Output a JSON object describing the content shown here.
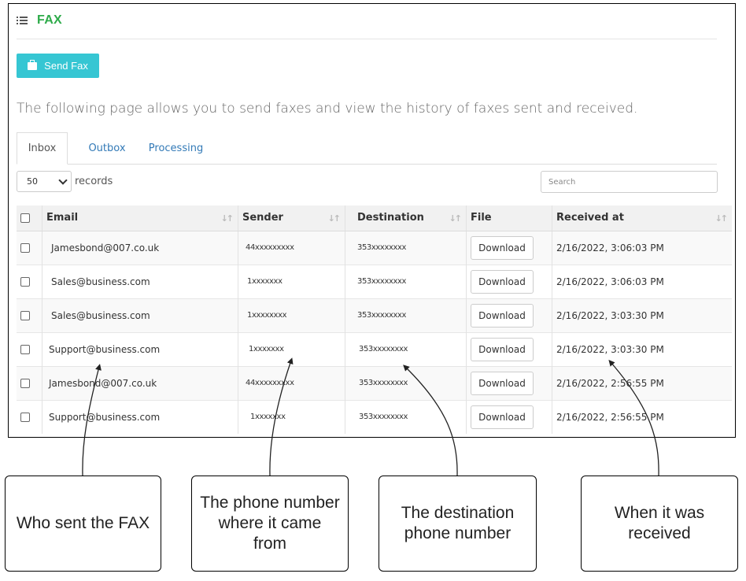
{
  "header": {
    "title": "FAX",
    "menu_icon": "list-icon"
  },
  "actions": {
    "send_fax_label": "Send Fax",
    "send_fax_icon": "briefcase-icon",
    "accent_color": "#36c6d3"
  },
  "description": "The following page allows you to send faxes and view the history of faxes sent and received.",
  "tabs": [
    {
      "label": "Inbox",
      "active": true
    },
    {
      "label": "Outbox",
      "active": false
    },
    {
      "label": "Processing",
      "active": false
    }
  ],
  "length": {
    "value": "50",
    "label": "records"
  },
  "search": {
    "placeholder": "Search",
    "value": ""
  },
  "table": {
    "columns": [
      "Email",
      "Sender",
      "Destination",
      "File",
      "Received at"
    ],
    "rows": [
      {
        "email": "Jamesbond@007.co.uk",
        "sender": "44xxxxxxxxx",
        "destination": "353xxxxxxxx",
        "file": "Download",
        "received": "2/16/2022, 3:06:03 PM"
      },
      {
        "email": "Sales@business.com",
        "sender": "1xxxxxxx",
        "destination": "353xxxxxxxx",
        "file": "Download",
        "received": "2/16/2022, 3:06:03 PM"
      },
      {
        "email": "Sales@business.com",
        "sender": "1xxxxxxxx",
        "destination": "353xxxxxxxx",
        "file": "Download",
        "received": "2/16/2022, 3:03:30 PM"
      },
      {
        "email": "Support@business.com",
        "sender": "1xxxxxxx",
        "destination": "353xxxxxxxx",
        "file": "Download",
        "received": "2/16/2022, 3:03:30 PM"
      },
      {
        "email": "Jamesbond@007.co.uk",
        "sender": "44xxxxxxxxx",
        "destination": "353xxxxxxxx",
        "file": "Download",
        "received": "2/16/2022, 2:56:55 PM"
      },
      {
        "email": "Support@business.com",
        "sender": "1xxxxxxx",
        "destination": "353xxxxxxxx",
        "file": "Download",
        "received": "2/16/2022, 2:56:55 PM"
      }
    ]
  },
  "callouts": [
    {
      "text": "Who sent the FAX"
    },
    {
      "text": "The phone number where it came from"
    },
    {
      "text": "The destination phone number"
    },
    {
      "text": "When it was received"
    }
  ]
}
